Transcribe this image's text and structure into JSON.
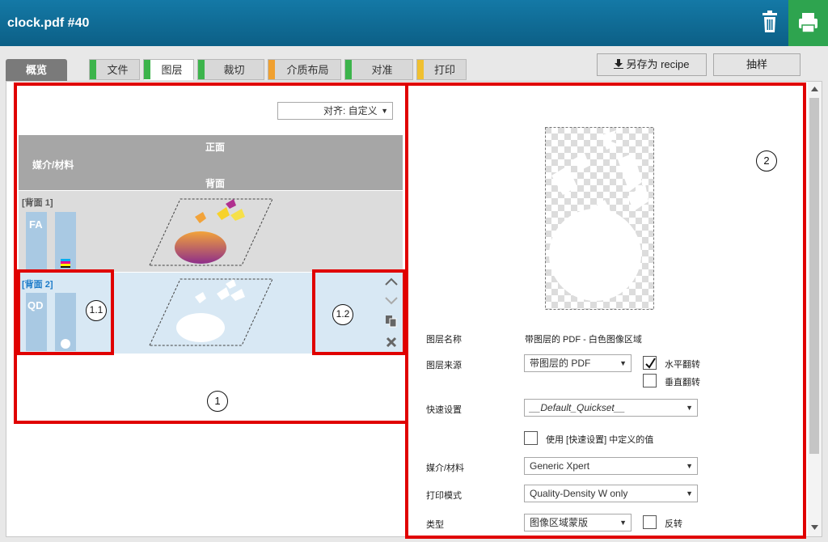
{
  "title": "clock.pdf #40",
  "header": {
    "trash_icon": "trash-icon",
    "print_icon": "printer-icon"
  },
  "tabs": {
    "overview": "概览",
    "file": "文件",
    "layers": "图层",
    "crop": "裁切",
    "media_layout": "介质布局",
    "align": "对准",
    "print": "打印"
  },
  "buttons": {
    "save_recipe": "另存为 recipe",
    "sample": "抽样"
  },
  "left": {
    "align_select": "对齐: 自定义",
    "header_front": "正面",
    "header_media": "媒介/材料",
    "header_back": "背面",
    "row1_label": "[背面 1]",
    "row1_code": "FA",
    "row2_label": "[背面 2]",
    "row2_code": "QD"
  },
  "annotations": {
    "a1": "1",
    "a11": "1.1",
    "a12": "1.2",
    "a2": "2"
  },
  "form": {
    "layer_name_label": "图层名称",
    "layer_name_value": "带图层的 PDF - 白色图像区域",
    "layer_source_label": "图层来源",
    "layer_source_value": "带图层的 PDF",
    "flip_h_label": "水平翻转",
    "flip_v_label": "垂直翻转",
    "quickset_label": "快速设置",
    "quickset_value": "__Default_Quickset__",
    "use_quickset_label": "使用 [快速设置] 中定义的值",
    "media_label": "媒介/材料",
    "media_value": "Generic Xpert",
    "print_mode_label": "打印模式",
    "print_mode_value": "Quality-Density W only",
    "type_label": "类型",
    "type_value": "图像区域蒙版",
    "invert_label": "反转"
  },
  "colors": {
    "accent": "#0c6d98",
    "print_green": "#2ea44f",
    "annotation_red": "#e00000"
  }
}
